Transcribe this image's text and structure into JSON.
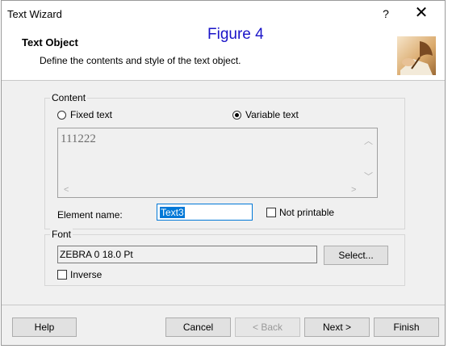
{
  "window": {
    "title": "Text Wizard",
    "help_glyph": "?",
    "close_glyph": "✕"
  },
  "header": {
    "title": "Text Object",
    "description": "Define the contents and style of the text object.",
    "figure_label": "Figure 4",
    "icon": "wizard-quill-icon"
  },
  "content": {
    "legend": "Content",
    "fixed_text_label": "Fixed text",
    "variable_text_label": "Variable text",
    "selected": "Variable text",
    "text_value": "111222",
    "element_name_label": "Element name:",
    "element_name_value": "Text3",
    "not_printable_label": "Not printable",
    "not_printable_checked": false
  },
  "font": {
    "legend": "Font",
    "value": "ZEBRA 0 18.0 Pt",
    "select_label": "Select...",
    "inverse_label": "Inverse",
    "inverse_checked": false
  },
  "buttons": {
    "help": "Help",
    "cancel": "Cancel",
    "back": "< Back",
    "next": "Next >",
    "finish": "Finish"
  }
}
